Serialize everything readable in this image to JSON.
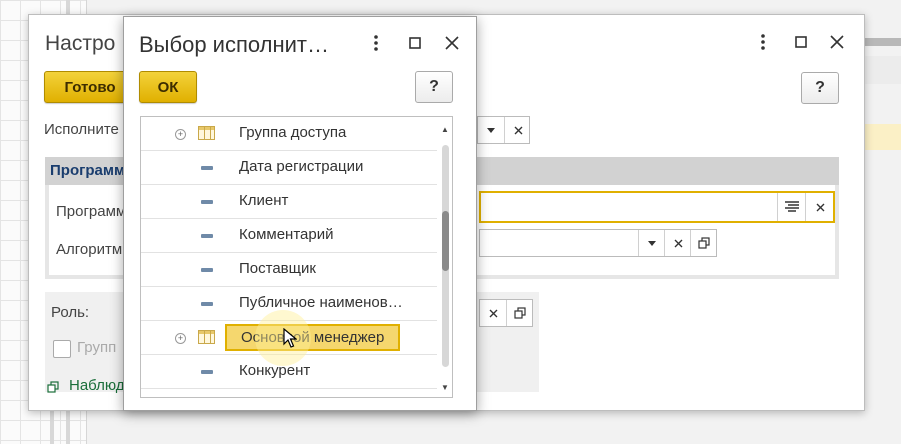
{
  "back_dialog": {
    "title": "Настро",
    "done_label": "Готово",
    "help_label": "?",
    "executor_label": "Исполните",
    "group_title": "Программ",
    "program_label": "Программ",
    "algorithm_label": "Алгоритм",
    "role_label": "Роль:",
    "group_checkbox_label": "Групп",
    "observe_link": "Наблюд"
  },
  "front_dialog": {
    "title": "Выбор исполнит…",
    "ok_label": "ОК",
    "help_label": "?",
    "items": [
      {
        "label": "Группа доступа",
        "type": "table",
        "expandable": true,
        "selected": false
      },
      {
        "label": "Дата регистрации",
        "type": "field",
        "expandable": false,
        "selected": false
      },
      {
        "label": "Клиент",
        "type": "field",
        "expandable": false,
        "selected": false
      },
      {
        "label": "Комментарий",
        "type": "field",
        "expandable": false,
        "selected": false
      },
      {
        "label": "Поставщик",
        "type": "field",
        "expandable": false,
        "selected": false
      },
      {
        "label": "Публичное наименов…",
        "type": "field",
        "expandable": false,
        "selected": false
      },
      {
        "label": "Основной менеджер",
        "type": "table",
        "expandable": true,
        "selected": true
      },
      {
        "label": "Конкурент",
        "type": "field",
        "expandable": false,
        "selected": false
      }
    ]
  },
  "icons": {
    "more": "more-vertical-icon",
    "maximize": "maximize-icon",
    "close": "close-icon"
  },
  "colors": {
    "accent_yellow": "#e0b000",
    "selection_fill": "#f5d76e",
    "group_title": "#1a3d6e",
    "link_green": "#1a6e3a"
  }
}
